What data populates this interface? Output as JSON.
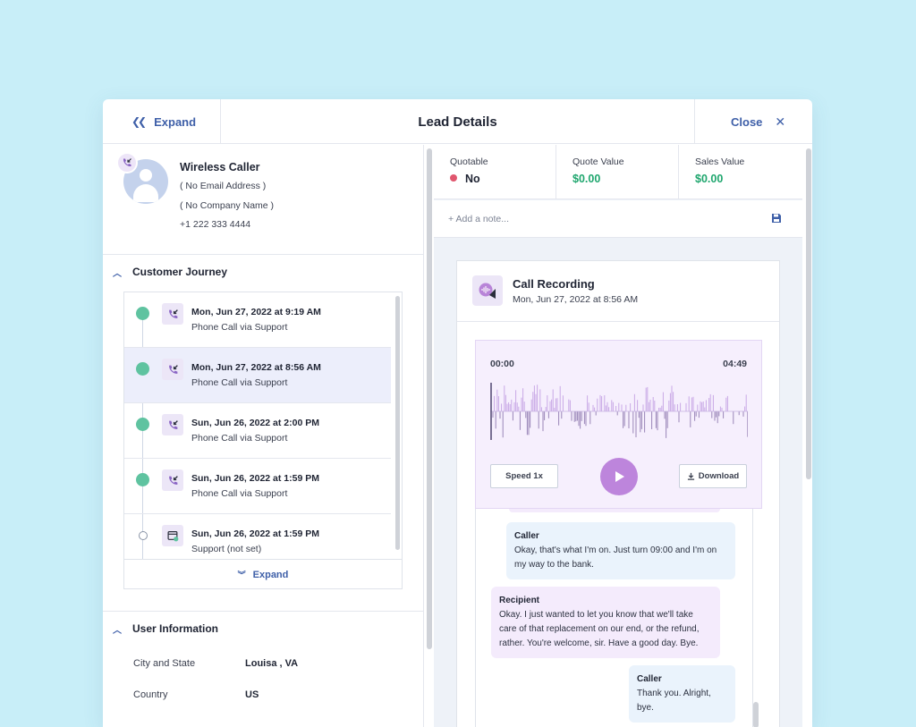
{
  "header": {
    "expand_label": "Expand",
    "title": "Lead Details",
    "close_label": "Close"
  },
  "contact": {
    "name": "Wireless Caller",
    "email": "( No Email Address )",
    "company": "( No Company Name )",
    "phone": "+1 222 333 4444"
  },
  "journey": {
    "title": "Customer Journey",
    "items": [
      {
        "title": "Mon, Jun 27, 2022 at 9:19 AM",
        "subtitle": "Phone Call via Support"
      },
      {
        "title": "Mon, Jun 27, 2022 at 8:56 AM",
        "subtitle": "Phone Call via Support"
      },
      {
        "title": "Sun, Jun 26, 2022 at 2:00 PM",
        "subtitle": "Phone Call via Support"
      },
      {
        "title": "Sun, Jun 26, 2022 at 1:59 PM",
        "subtitle": "Phone Call via Support"
      },
      {
        "title": "Sun, Jun 26, 2022 at 1:59 PM",
        "subtitle": "Support (not set)"
      }
    ],
    "expand_label": "Expand"
  },
  "user_info": {
    "title": "User Information",
    "rows": [
      {
        "label": "City and State",
        "value": "Louisa , VA"
      },
      {
        "label": "Country",
        "value": "US"
      }
    ]
  },
  "stats": {
    "quotable_label": "Quotable",
    "quotable_value": "No",
    "quote_value_label": "Quote Value",
    "quote_value": "$0.00",
    "sales_value_label": "Sales Value",
    "sales_value": "$0.00"
  },
  "note": {
    "placeholder": "+ Add a note..."
  },
  "recording": {
    "title": "Call Recording",
    "date": "Mon, Jun 27, 2022 at 8:56 AM",
    "time_start": "00:00",
    "time_end": "04:49",
    "speed_label": "Speed 1x",
    "download_label": "Download"
  },
  "transcript": [
    {
      "speaker": "Caller",
      "text": "Okay, that's what I'm on. Just turn 09:00 and I'm on my way to the bank."
    },
    {
      "speaker": "Recipient",
      "text": "Okay. I just wanted to let you know that we'll take care of that replacement on our end, or the refund, rather. You're welcome, sir. Have a good day. Bye."
    },
    {
      "speaker": "Caller",
      "text": "Thank you. Alright, bye."
    }
  ],
  "colors": {
    "accent": "#3e5fa8",
    "green": "#1fa66e",
    "journey_dot": "#5fc3a0",
    "red_dot": "#e0566e",
    "play": "#bd85dc",
    "background": "#c8eef8"
  }
}
